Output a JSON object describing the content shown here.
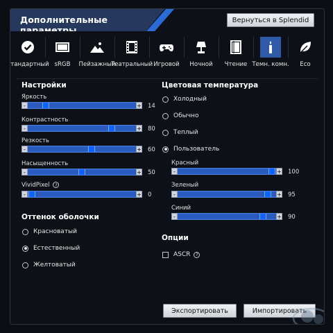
{
  "header": {
    "title": "Дополнительные параметры",
    "back_label": "Вернуться в Splendid"
  },
  "modes": [
    {
      "label": "Стандартный",
      "icon": "check-circle-icon",
      "active": false
    },
    {
      "label": "sRGB",
      "icon": "monitor-icon",
      "active": false
    },
    {
      "label": "Пейзажный",
      "icon": "landscape-icon",
      "active": false
    },
    {
      "label": "Театральный",
      "icon": "film-icon",
      "active": false
    },
    {
      "label": "Игровой",
      "icon": "gamepad-icon",
      "active": false
    },
    {
      "label": "Ночной",
      "icon": "lamp-icon",
      "active": false
    },
    {
      "label": "Чтение",
      "icon": "book-icon",
      "active": false
    },
    {
      "label": "Темн. комн.",
      "icon": "candle-icon",
      "active": true
    },
    {
      "label": "Eco",
      "icon": "leaf-icon",
      "active": false
    }
  ],
  "settings": {
    "title": "Настройки",
    "sliders": [
      {
        "label": "Яркость",
        "value": "14",
        "level": 0.14
      },
      {
        "label": "Контрастность",
        "value": "80",
        "level": 0.8
      },
      {
        "label": "Резкость",
        "value": "60",
        "level": 0.6
      },
      {
        "label": "Насыщенность",
        "value": "50",
        "level": 0.5
      },
      {
        "label": "VividPixel",
        "value": "0",
        "level": 0.0,
        "help": "?"
      }
    ]
  },
  "shell_tone": {
    "title": "Оттенок оболочки",
    "options": [
      {
        "label": "Красноватый",
        "checked": false
      },
      {
        "label": "Естественный",
        "checked": true
      },
      {
        "label": "Желтоватый",
        "checked": false
      }
    ]
  },
  "color_temp": {
    "title": "Цветовая температура",
    "options": [
      {
        "label": "Холодный",
        "checked": false
      },
      {
        "label": "Обычно",
        "checked": false
      },
      {
        "label": "Теплый",
        "checked": false
      },
      {
        "label": "Пользователь",
        "checked": true
      }
    ],
    "sliders": [
      {
        "label": "Красный",
        "value": "100",
        "level": 1.0
      },
      {
        "label": "Зеленый",
        "value": "95",
        "level": 0.95
      },
      {
        "label": "Синий",
        "value": "90",
        "level": 0.9
      }
    ]
  },
  "options": {
    "title": "Опции",
    "ascr_label": "ASCR",
    "ascr_checked": false,
    "help": "?"
  },
  "buttons": {
    "export": "Экспортировать",
    "import": "Импортировать"
  },
  "colors": {
    "accent": "#2a5cc0",
    "title_bg": "#26385e",
    "stripe": "#2a6bd6",
    "background": "#0d1016"
  }
}
